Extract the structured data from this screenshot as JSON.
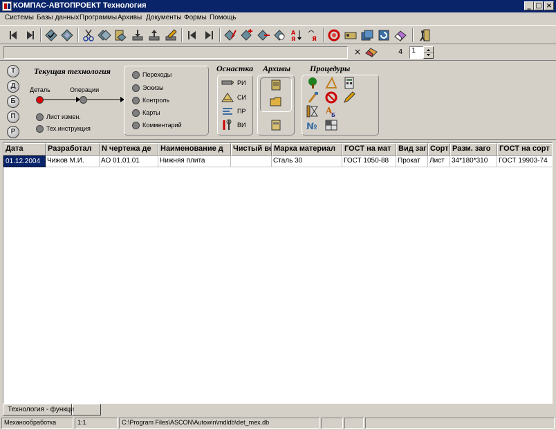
{
  "window": {
    "title": "КОМПАС-АВТОПРОЕКТ Технология"
  },
  "menu": [
    "Системы",
    "Базы данных",
    "Программы",
    "Архивы",
    "Документы",
    "Формы",
    "Помощь"
  ],
  "bar2": {
    "close": "×",
    "number": "4",
    "spin_value": "1"
  },
  "side_buttons": [
    "Т",
    "Д",
    "Б",
    "П",
    "Р"
  ],
  "tech": {
    "title": "Текущая технология",
    "detail_label": "Деталь",
    "operations_label": "Операции",
    "list_label": "Лист измен.",
    "tex_label": "Тех.инструкция",
    "items": [
      "Переходы",
      "Эскизы",
      "Контроль",
      "Карты",
      "Комментарий"
    ]
  },
  "osnastka": {
    "title": "Оснастка",
    "items": [
      "РИ",
      "СИ",
      "ПР",
      "ВИ"
    ]
  },
  "archives": {
    "title": "Архивы"
  },
  "procedures": {
    "title": "Процедуры"
  },
  "table": {
    "columns": [
      "Дата",
      "Разработал",
      "N чертежа де",
      "Наименование д",
      "Чистый ве",
      "Марка материал",
      "ГОСТ на мат",
      "Вид заг",
      "Сорт",
      "Разм. заго",
      "ГОСТ на сорт"
    ],
    "rows": [
      [
        "01.12.2004",
        "Чижов М.И.",
        "АО 01.01.01",
        "Нижняя плита",
        "",
        "Сталь 30",
        "ГОСТ 1050-88",
        "Прокат",
        "Лист",
        "34*180*310",
        "ГОСТ 19903-74"
      ]
    ]
  },
  "tabs": [
    "Технология - функци",
    ""
  ],
  "status": [
    "Механообработка",
    "1:1",
    "C:\\Program Files\\ASCON\\Autowin\\mdldb\\det_mex.db",
    "",
    "",
    ""
  ],
  "colors": {
    "titlebar": "#0a246a",
    "face": "#d4d0c8",
    "selection": "#0a246a",
    "detail_dot": "#e00000"
  }
}
